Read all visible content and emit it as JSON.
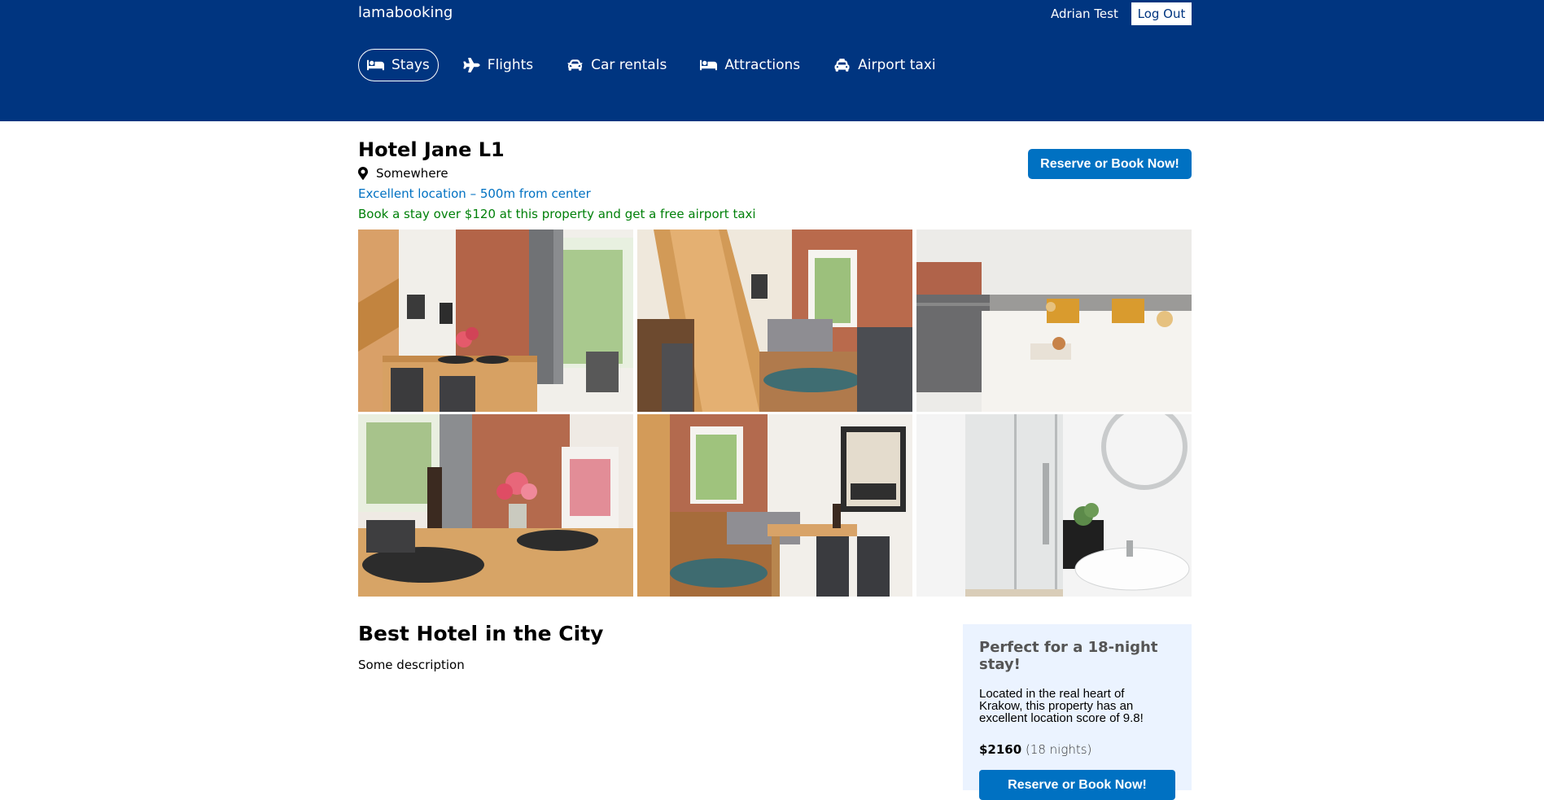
{
  "header": {
    "logo": "lamabooking",
    "user_name": "Adrian Test",
    "logout_label": "Log Out",
    "brand_color": "#003580"
  },
  "nav": {
    "items": [
      {
        "label": "Stays",
        "icon": "bed-icon",
        "active": true
      },
      {
        "label": "Flights",
        "icon": "plane-icon",
        "active": false
      },
      {
        "label": "Car rentals",
        "icon": "car-icon",
        "active": false
      },
      {
        "label": "Attractions",
        "icon": "bed-icon",
        "active": false
      },
      {
        "label": "Airport taxi",
        "icon": "taxi-icon",
        "active": false
      }
    ]
  },
  "hotel": {
    "name": "Hotel Jane L1",
    "address": "Somewhere",
    "distance": "Excellent location – 500m from center",
    "price_highlight": "Book a stay over $120 at this property and get a free airport taxi",
    "book_label": "Reserve or Book Now!",
    "photos": [
      {
        "name": "dining-room-photo"
      },
      {
        "name": "living-room-stairs-photo"
      },
      {
        "name": "bedroom-photo"
      },
      {
        "name": "table-setting-photo"
      },
      {
        "name": "lounge-polska-photo"
      },
      {
        "name": "bathroom-photo"
      }
    ]
  },
  "details": {
    "title": "Best Hotel in the City",
    "description": "Some description"
  },
  "sidebar": {
    "title": "Perfect for a 18-night stay!",
    "text": "Located in the real heart of Krakow, this property has an excellent location score of 9.8!",
    "price": "$2160",
    "nights": "(18 nights)",
    "book_label": "Reserve or Book Now!"
  },
  "colors": {
    "accent": "#0071c2",
    "green": "#008009",
    "sidebar_bg": "#ebf3ff"
  }
}
